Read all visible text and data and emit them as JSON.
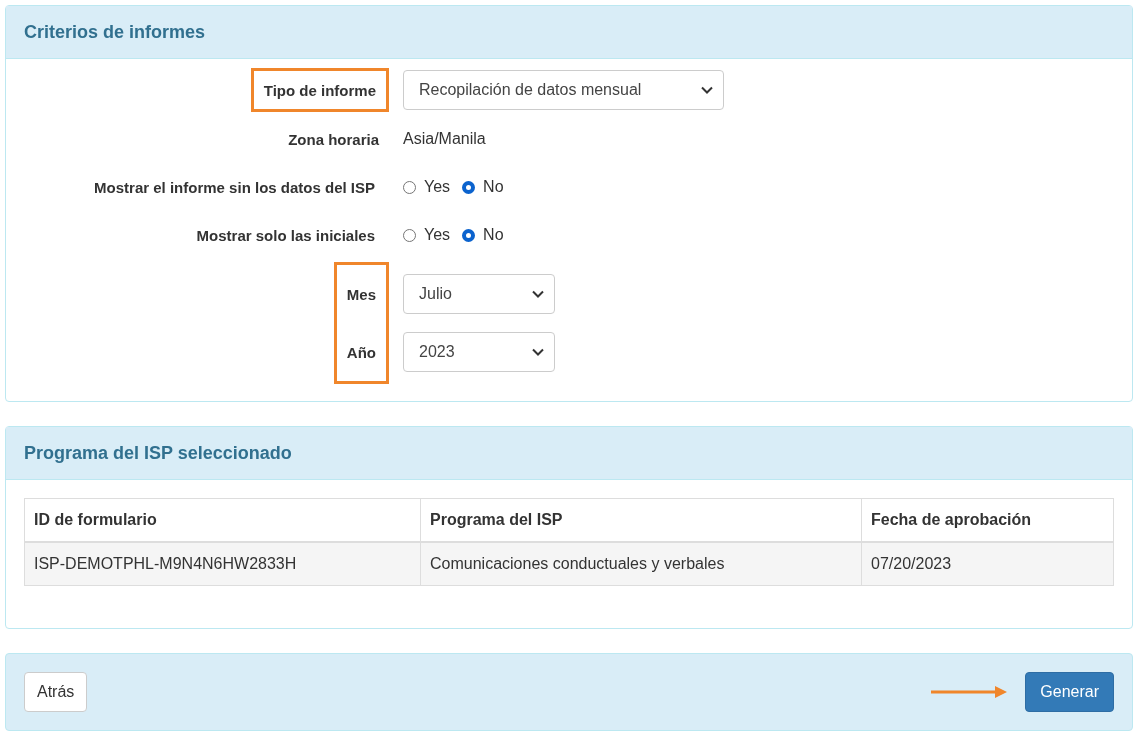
{
  "criteria": {
    "title": "Criterios de informes",
    "groups": [
      {
        "highlighted": true,
        "fields": [
          {
            "kind": "select",
            "label": "Tipo de informe",
            "value": "Recopilación de datos mensual"
          }
        ]
      },
      {
        "highlighted": false,
        "fields": [
          {
            "kind": "text",
            "label": "Zona horaria",
            "value": "Asia/Manila"
          },
          {
            "kind": "radio",
            "label": "Mostrar el informe sin los datos del ISP",
            "options": [
              {
                "label": "Yes",
                "selected": false
              },
              {
                "label": "No",
                "selected": true
              }
            ]
          },
          {
            "kind": "radio",
            "label": "Mostrar solo las iniciales",
            "options": [
              {
                "label": "Yes",
                "selected": false
              },
              {
                "label": "No",
                "selected": true
              }
            ]
          }
        ]
      },
      {
        "highlighted": true,
        "fields": [
          {
            "kind": "select",
            "label": "Mes",
            "value": "Julio"
          },
          {
            "kind": "select",
            "label": "Año",
            "value": "2023"
          }
        ]
      }
    ]
  },
  "program": {
    "title": "Programa del ISP seleccionado",
    "columns": [
      "ID de formulario",
      "Programa del ISP",
      "Fecha de aprobación"
    ],
    "rows": [
      [
        "ISP-DEMOTPHL-M9N4N6HW2833H",
        "Comunicaciones conductuales y verbales",
        "07/20/2023"
      ]
    ]
  },
  "footer": {
    "back": "Atrás",
    "generate": "Generar",
    "pointer_arrow": true
  }
}
